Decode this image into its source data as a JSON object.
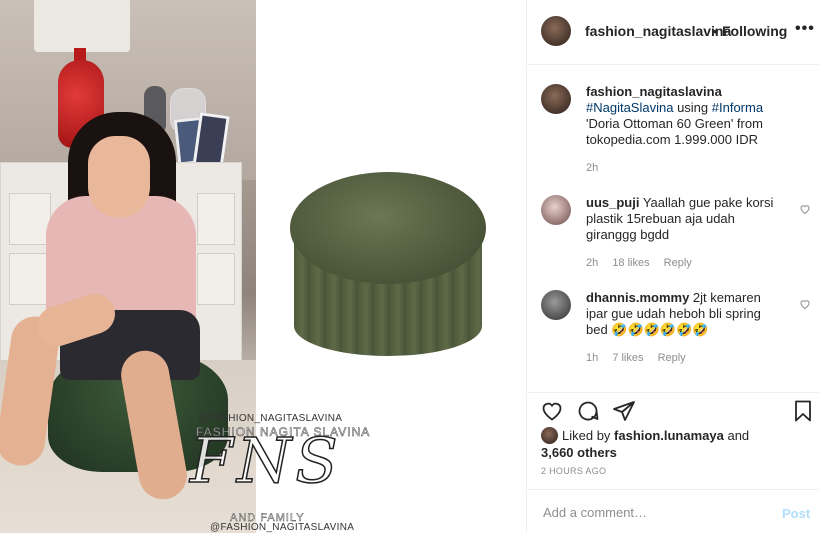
{
  "media": {
    "watermark_handle_top": "@FASHION_NAGITASLAVINA",
    "watermark_name": "FASHION NAGITA SLAVINA",
    "watermark_logo": "FNS",
    "watermark_family": "AND FAMILY",
    "watermark_handle_bottom": "@FASHION_NAGITASLAVINA"
  },
  "header": {
    "username": "fashion_nagitaslavina",
    "separator": "•",
    "follow_status": "Following",
    "more_icon": "more-horizontal-icon",
    "more_label": "•••"
  },
  "caption": {
    "username": "fashion_nagitaslavina",
    "hashtag1": "#NagitaSlavina",
    "text1": " using ",
    "hashtag2": "#Informa",
    "text2": " 'Doria Ottoman 60 Green' from tokopedia.com 1.999.000 IDR",
    "time": "2h"
  },
  "comments": [
    {
      "username": "uus_puji",
      "text": " Yaallah gue pake korsi plastik 15rebuan aja udah giranggg bgdd",
      "time": "2h",
      "likes": "18 likes",
      "reply": "Reply"
    },
    {
      "username": "dhannis.mommy",
      "text": " 2jt kemaren ipar gue udah heboh bli spring bed 🤣🤣🤣🤣🤣🤣",
      "time": "1h",
      "likes": "7 likes",
      "reply": "Reply"
    }
  ],
  "actions": {
    "like_icon": "heart-icon",
    "comment_icon": "comment-icon",
    "share_icon": "share-icon",
    "save_icon": "bookmark-icon"
  },
  "likes": {
    "prefix": "Liked by ",
    "user": "fashion.lunamaya",
    "middle": " and",
    "count": "3,660 others"
  },
  "timestamp": "2 HOURS AGO",
  "add_comment": {
    "placeholder": "Add a comment…",
    "post_label": "Post"
  },
  "colors": {
    "link": "#00376b",
    "muted": "#8e8e8e",
    "post_disabled": "#b2dffc"
  }
}
